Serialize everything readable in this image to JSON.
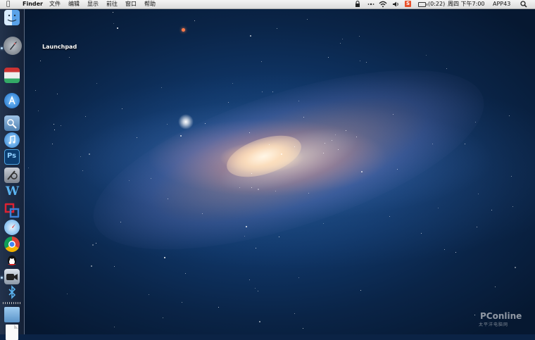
{
  "menubar": {
    "apple_glyph": "",
    "app_name": "Finder",
    "menus": [
      "文件",
      "编辑",
      "显示",
      "前往",
      "窗口",
      "帮助"
    ],
    "status": {
      "sogou_label": "S",
      "battery_time": "(0:22)",
      "clock": "周四 下午7:00",
      "user": "APP43"
    }
  },
  "dock": {
    "items": [
      {
        "name": "finder"
      },
      {
        "name": "launchpad"
      },
      {
        "name": "photo-booth"
      },
      {
        "name": "app-store"
      },
      {
        "name": "preview"
      },
      {
        "name": "itunes"
      },
      {
        "name": "photoshop"
      },
      {
        "name": "system-preferences"
      },
      {
        "name": "word"
      },
      {
        "name": "parallels"
      },
      {
        "name": "safari"
      },
      {
        "name": "chrome"
      },
      {
        "name": "qq"
      },
      {
        "name": "facetime"
      },
      {
        "name": "bluetooth"
      },
      {
        "name": "applications-folder"
      },
      {
        "name": "documents"
      }
    ],
    "tooltip": "Launchpad",
    "icon_labels": {
      "photoshop": "Ps",
      "word": "W"
    }
  },
  "watermark": {
    "brand": "PConline",
    "tagline": "太平洋电脑网"
  },
  "colors": {
    "menubar_bg": "#e6e6e6",
    "sogou": "#e9502a",
    "sky": "#0f3566"
  }
}
